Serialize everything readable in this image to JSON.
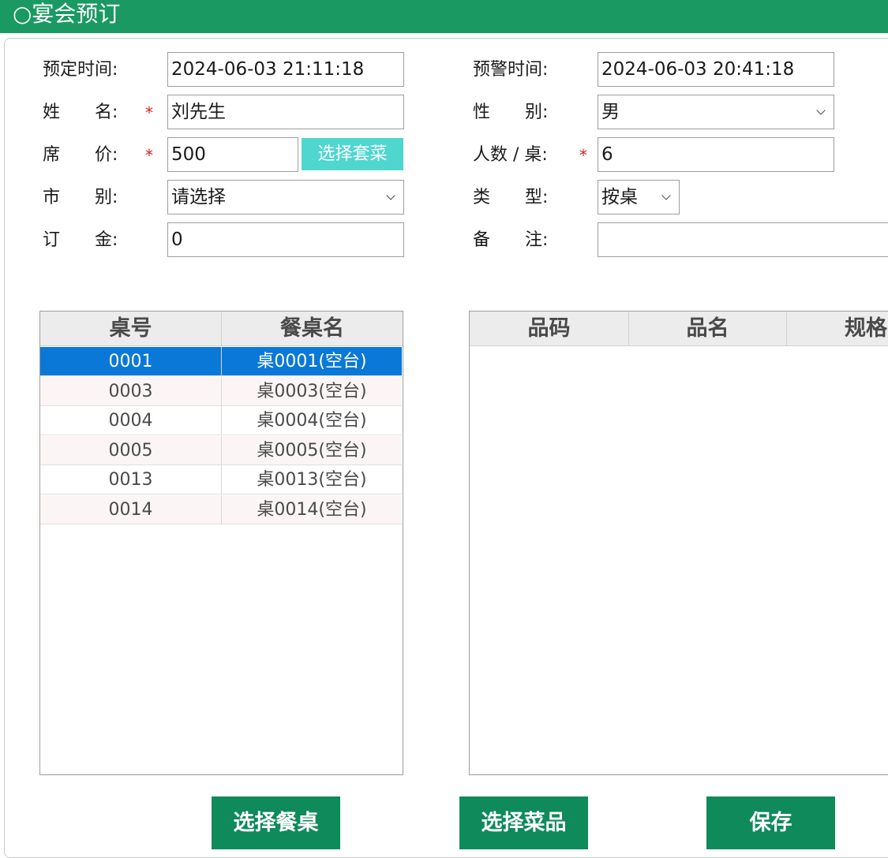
{
  "window": {
    "title": "○宴会预订"
  },
  "form": {
    "book_time": {
      "label": "预定时间:",
      "value": "2024-06-03     21:11:18"
    },
    "warn_time": {
      "label": "预警时间:",
      "value": "2024-06-03     20:41:18"
    },
    "name": {
      "label": "姓　　名:",
      "required": "*",
      "value": "刘先生"
    },
    "gender": {
      "label": "性　　别:",
      "value": "男"
    },
    "price": {
      "label": "席　　价:",
      "required": "*",
      "value": "500",
      "button": "选择套菜"
    },
    "people": {
      "label": "人数 / 桌:",
      "required": "*",
      "value": "6"
    },
    "market": {
      "label": "市　　别:",
      "value": "请选择"
    },
    "type": {
      "label": "类　　型:",
      "value": "按桌"
    },
    "deposit": {
      "label": "订　　金:",
      "value": "0"
    },
    "remark": {
      "label": "备　　注:",
      "value": ""
    }
  },
  "table_grid": {
    "headers": [
      "桌号",
      "餐桌名"
    ],
    "rows": [
      [
        "0001",
        "桌0001(空台)"
      ],
      [
        "0003",
        "桌0003(空台)"
      ],
      [
        "0004",
        "桌0004(空台)"
      ],
      [
        "0005",
        "桌0005(空台)"
      ],
      [
        "0013",
        "桌0013(空台)"
      ],
      [
        "0014",
        "桌0014(空台)"
      ]
    ],
    "selected_row": 0
  },
  "dish_grid": {
    "headers": [
      "品码",
      "品名",
      "规格"
    ],
    "rows": []
  },
  "buttons": {
    "select_table": "选择餐桌",
    "select_dish": "选择菜品",
    "save": "保存"
  },
  "colors": {
    "titlebar": "#1a9a62",
    "primary_button": "#0f8a5a",
    "accent_button": "#4fd6cf",
    "selection": "#0a78d7",
    "required": "#e02020"
  }
}
